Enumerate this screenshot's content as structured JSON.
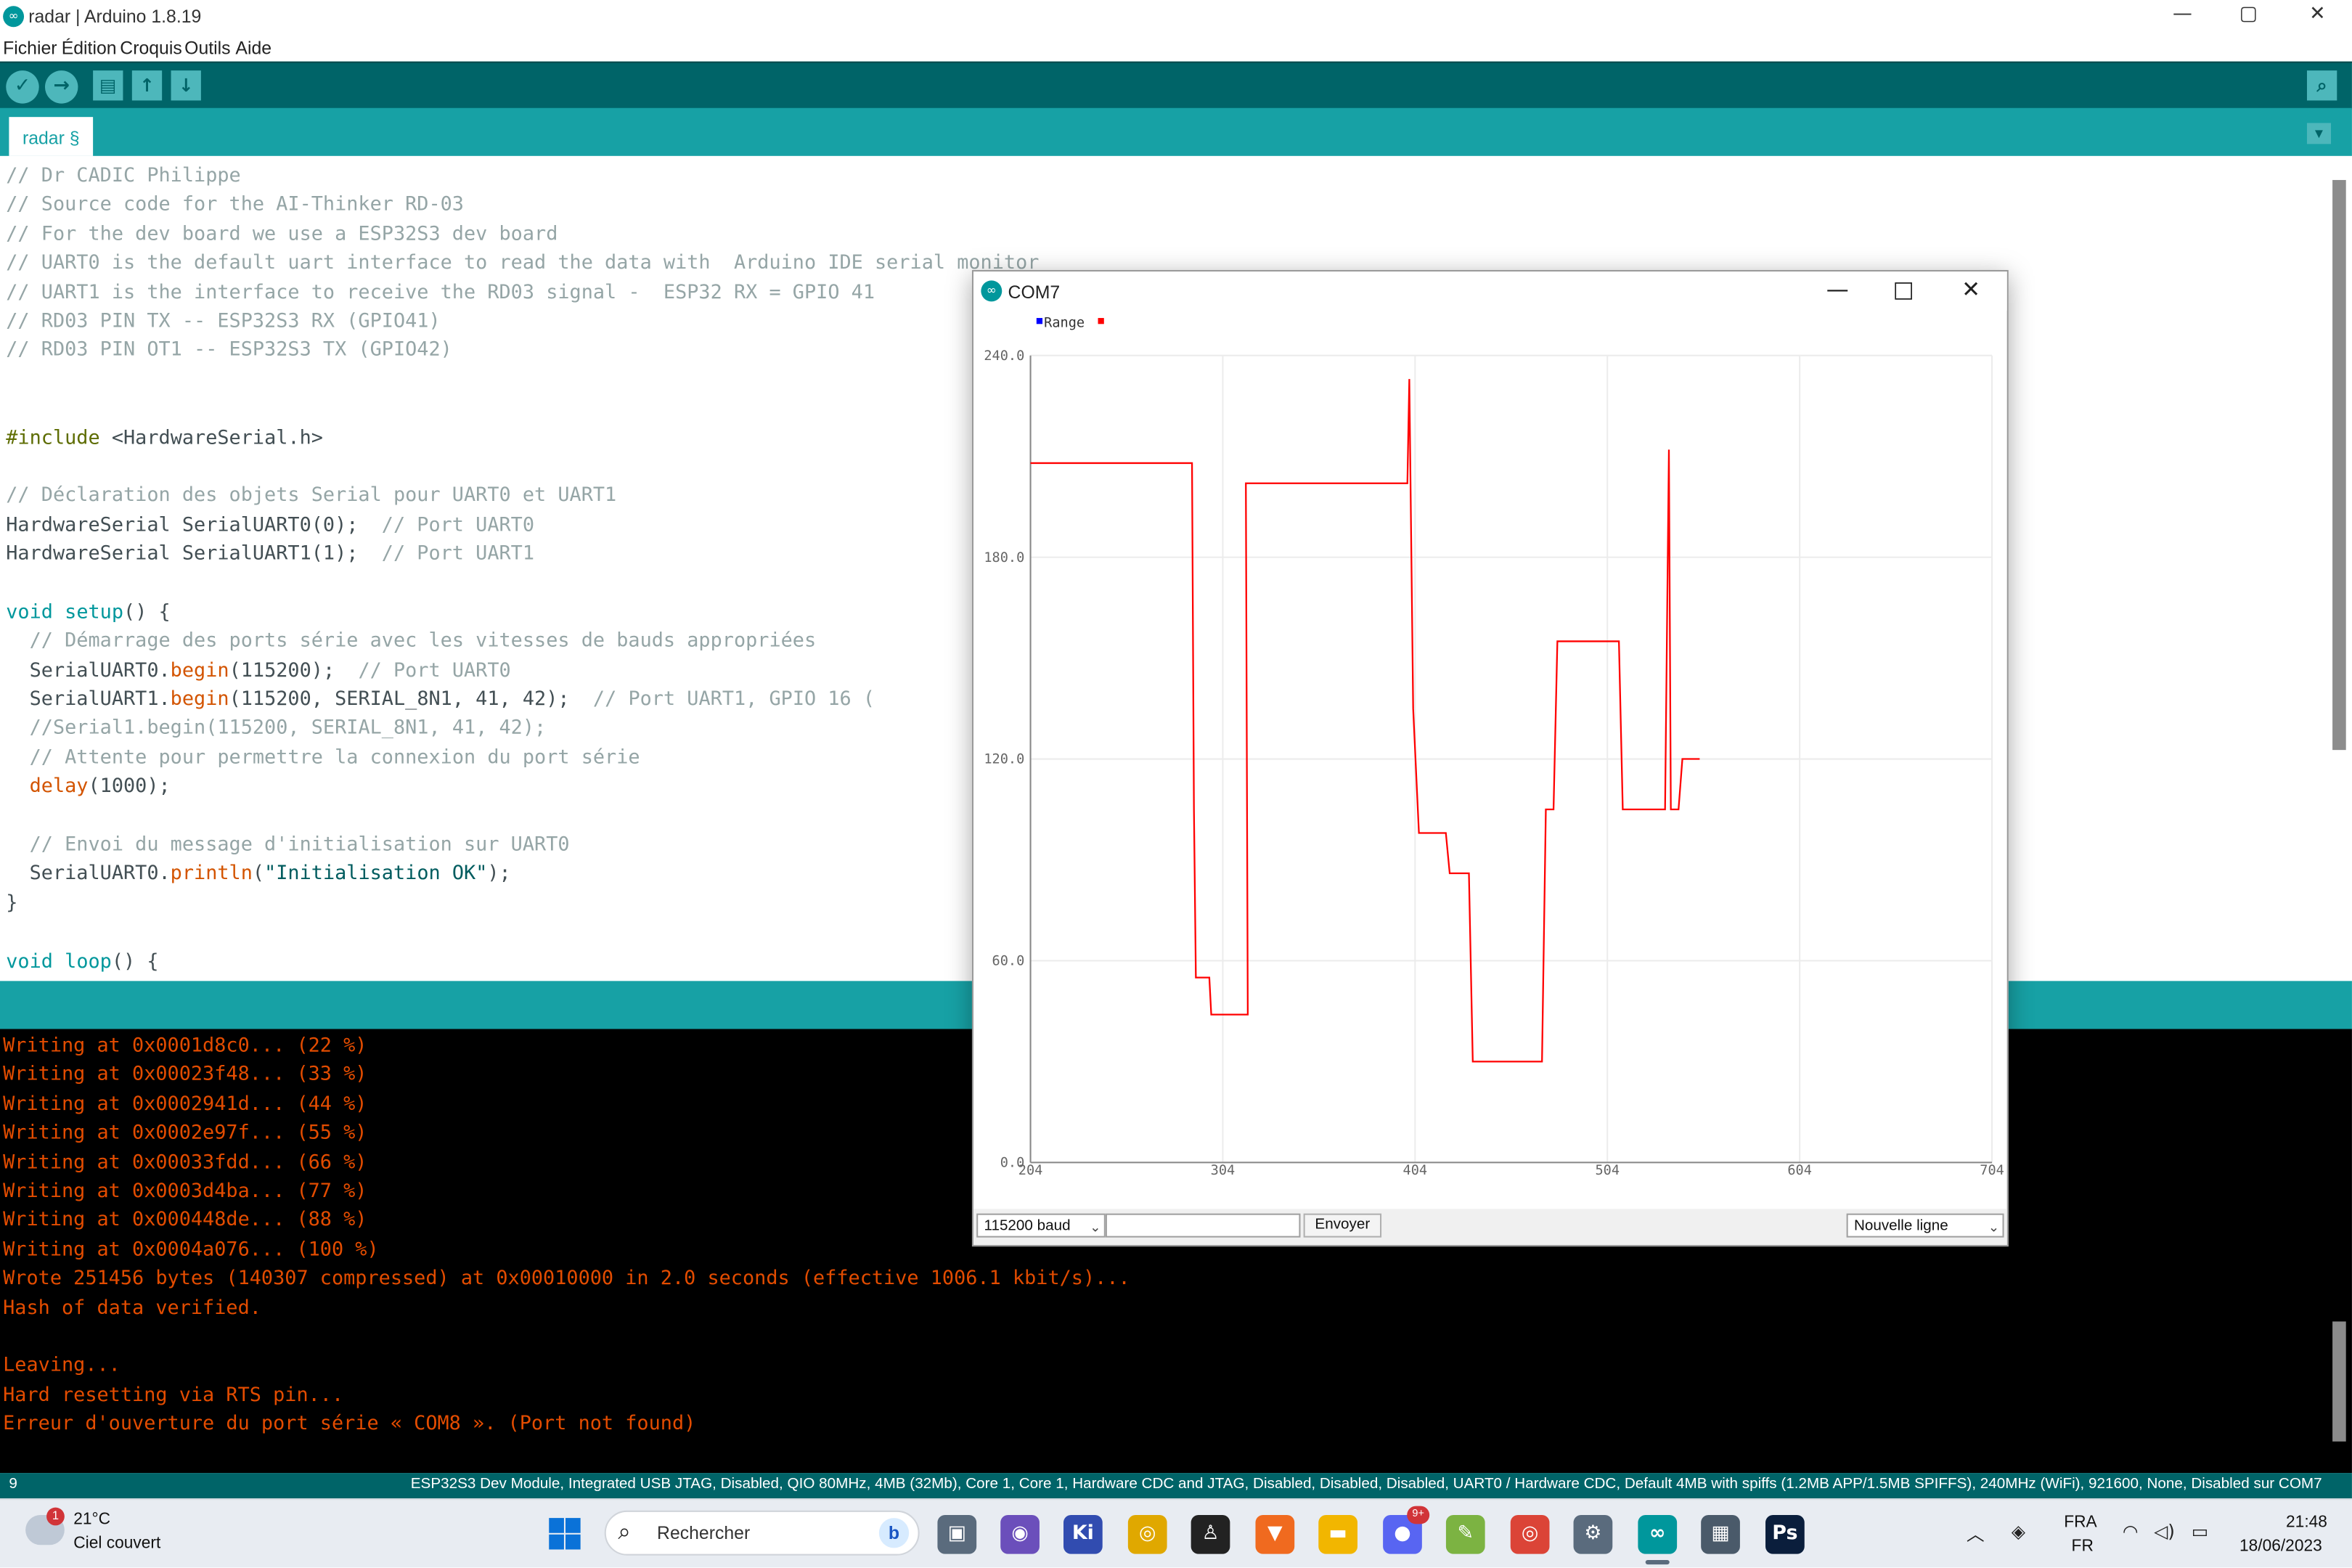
{
  "window": {
    "title": "radar | Arduino 1.8.19",
    "controls": {
      "minimize": "—",
      "maximize": "▢",
      "close": "✕"
    }
  },
  "menu": [
    "Fichier",
    "Édition",
    "Croquis",
    "Outils",
    "Aide"
  ],
  "toolbar": {
    "buttons": [
      "verify-icon",
      "upload-icon",
      "new-icon",
      "open-icon",
      "save-icon",
      "serial-monitor-icon"
    ],
    "glyphs": {
      "verify": "✓",
      "upload": "→",
      "new": "▤",
      "open": "↑",
      "save": "↓",
      "monitor": "⌕"
    }
  },
  "tab": {
    "label": "radar §",
    "menu_glyph": "▼"
  },
  "editor": {
    "lines": [
      [
        {
          "t": "// Dr CADIC Philippe",
          "c": "cm"
        }
      ],
      [
        {
          "t": "// Source code for the AI-Thinker RD-03",
          "c": "cm"
        }
      ],
      [
        {
          "t": "// For the dev board we use a ESP32S3 dev board",
          "c": "cm"
        }
      ],
      [
        {
          "t": "// UART0 is the default uart interface to read the data with  Arduino IDE serial monitor",
          "c": "cm"
        }
      ],
      [
        {
          "t": "// UART1 is the interface to receive the RD03 signal -  ESP32 RX = GPIO 41",
          "c": "cm"
        }
      ],
      [
        {
          "t": "// RD03 PIN TX -- ESP32S3 RX (GPIO41)",
          "c": "cm"
        }
      ],
      [
        {
          "t": "// RD03 PIN OT1 -- ESP32S3 TX (GPIO42)",
          "c": "cm"
        }
      ],
      [],
      [],
      [
        {
          "t": "#include",
          "c": "pp"
        },
        {
          "t": " <HardwareSerial.h>",
          "c": ""
        }
      ],
      [],
      [
        {
          "t": "// Déclaration des objets Serial pour UART0 et UART1",
          "c": "cm"
        }
      ],
      [
        {
          "t": "HardwareSerial SerialUART0(0);  ",
          "c": ""
        },
        {
          "t": "// Port UART0",
          "c": "cm"
        }
      ],
      [
        {
          "t": "HardwareSerial SerialUART1(1);  ",
          "c": ""
        },
        {
          "t": "// Port UART1",
          "c": "cm"
        }
      ],
      [],
      [
        {
          "t": "void",
          "c": "kw"
        },
        {
          "t": " ",
          "c": ""
        },
        {
          "t": "setup",
          "c": "kw"
        },
        {
          "t": "() {",
          "c": ""
        }
      ],
      [
        {
          "t": "  ",
          "c": ""
        },
        {
          "t": "// Démarrage des ports série avec les vitesses de bauds appropriées",
          "c": "cm"
        }
      ],
      [
        {
          "t": "  SerialUART0.",
          "c": ""
        },
        {
          "t": "begin",
          "c": "fn"
        },
        {
          "t": "(115200);  ",
          "c": ""
        },
        {
          "t": "// Port UART0",
          "c": "cm"
        }
      ],
      [
        {
          "t": "  SerialUART1.",
          "c": ""
        },
        {
          "t": "begin",
          "c": "fn"
        },
        {
          "t": "(115200, SERIAL_8N1, 41, 42);  ",
          "c": ""
        },
        {
          "t": "// Port UART1, GPIO 16 (",
          "c": "cm"
        }
      ],
      [
        {
          "t": "  ",
          "c": ""
        },
        {
          "t": "//Serial1.begin(115200, SERIAL_8N1, 41, 42);",
          "c": "cm"
        }
      ],
      [
        {
          "t": "  ",
          "c": ""
        },
        {
          "t": "// Attente pour permettre la connexion du port série",
          "c": "cm"
        }
      ],
      [
        {
          "t": "  ",
          "c": ""
        },
        {
          "t": "delay",
          "c": "fn"
        },
        {
          "t": "(1000);",
          "c": ""
        }
      ],
      [],
      [
        {
          "t": "  ",
          "c": ""
        },
        {
          "t": "// Envoi du message d'initialisation sur UART0",
          "c": "cm"
        }
      ],
      [
        {
          "t": "  SerialUART0.",
          "c": ""
        },
        {
          "t": "println",
          "c": "fn"
        },
        {
          "t": "(",
          "c": ""
        },
        {
          "t": "\"Initialisation OK\"",
          "c": "st"
        },
        {
          "t": ");",
          "c": ""
        }
      ],
      [
        {
          "t": "}",
          "c": ""
        }
      ],
      [],
      [
        {
          "t": "void",
          "c": "kw"
        },
        {
          "t": " ",
          "c": ""
        },
        {
          "t": "loop",
          "c": "kw"
        },
        {
          "t": "() {",
          "c": ""
        }
      ]
    ]
  },
  "console": {
    "lines": [
      "Writing at 0x0001d8c0... (22 %)",
      "Writing at 0x00023f48... (33 %)",
      "Writing at 0x0002941d... (44 %)",
      "Writing at 0x0002e97f... (55 %)",
      "Writing at 0x00033fdd... (66 %)",
      "Writing at 0x0003d4ba... (77 %)",
      "Writing at 0x000448de... (88 %)",
      "Writing at 0x0004a076... (100 %)",
      "Wrote 251456 bytes (140307 compressed) at 0x00010000 in 2.0 seconds (effective 1006.1 kbit/s)...",
      "Hash of data verified.",
      "",
      "Leaving...",
      "Hard resetting via RTS pin...",
      "Erreur d'ouverture du port série « COM8 ». (Port not found)"
    ]
  },
  "status": {
    "line_number": "9",
    "board": "ESP32S3 Dev Module, Integrated USB JTAG, Disabled, QIO 80MHz, 4MB (32Mb), Core 1, Core 1, Hardware CDC and JTAG, Disabled, Disabled, Disabled, UART0 / Hardware CDC, Default 4MB with spiffs (1.2MB APP/1.5MB SPIFFS), 240MHz (WiFi), 921600, None, Disabled sur COM7"
  },
  "plotter": {
    "title": "COM7",
    "controls": {
      "minimize": "—",
      "maximize": "□",
      "close": "✕"
    },
    "baud": "115200 baud",
    "input_value": "",
    "send_label": "Envoyer",
    "line_ending": "Nouvelle ligne",
    "select_arrow": "⌄"
  },
  "chart_data": {
    "type": "line",
    "legend": "Range",
    "legend_colors": [
      "#0000ff",
      "#ff0000"
    ],
    "series_color": "#ff0000",
    "xlim": [
      204,
      704
    ],
    "ylim": [
      0,
      240
    ],
    "x_ticks": [
      "204",
      "304",
      "404",
      "504",
      "604",
      "704"
    ],
    "y_ticks": [
      "0.0",
      "60.0",
      "120.0",
      "180.0",
      "240.0"
    ],
    "grid": true,
    "series": [
      {
        "name": "Range",
        "x": [
          204,
          288,
          289,
          290,
          294,
          297,
          298,
          306,
          307,
          315,
          317,
          316,
          395,
          396,
          399,
          400,
          401,
          403,
          406,
          420,
          422,
          432,
          434,
          470,
          472,
          476,
          478,
          482,
          484,
          510,
          512,
          532,
          534,
          536,
          537,
          538,
          541,
          543,
          552
        ],
        "y": [
          208,
          208,
          105,
          55,
          55,
          55,
          44,
          44,
          44,
          44,
          44,
          202,
          202,
          202,
          202,
          202,
          233,
          135,
          98,
          98,
          86,
          86,
          30,
          30,
          105,
          105,
          155,
          155,
          155,
          155,
          105,
          105,
          105,
          212,
          105,
          105,
          105,
          120,
          120
        ]
      }
    ]
  },
  "taskbar": {
    "weather_badge": "1",
    "temperature": "21°C",
    "condition": "Ciel couvert",
    "search_placeholder": "Rechercher",
    "search_glyph": "⌕",
    "bing_glyph": "b",
    "apps": [
      {
        "name": "task-view-icon",
        "glyph": "▣",
        "color": "#5a6b7d"
      },
      {
        "name": "video-chat-icon",
        "glyph": "◉",
        "color": "#6b4fbb"
      },
      {
        "name": "kicad-icon",
        "glyph": "Ki",
        "color": "#314cb0"
      },
      {
        "name": "chrome-icon",
        "glyph": "◎",
        "color": "#e0a800"
      },
      {
        "name": "inkscape-icon",
        "glyph": "♙",
        "color": "#222222"
      },
      {
        "name": "brave-icon",
        "glyph": "▼",
        "color": "#f06a1f"
      },
      {
        "name": "file-explorer-icon",
        "glyph": "▬",
        "color": "#f2b600"
      },
      {
        "name": "discord-icon",
        "glyph": "●",
        "color": "#5865f2"
      },
      {
        "name": "notepadpp-icon",
        "glyph": "✎",
        "color": "#7cb342"
      },
      {
        "name": "chrome-profile-icon",
        "glyph": "◎",
        "color": "#db4437"
      },
      {
        "name": "settings-icon",
        "glyph": "⚙",
        "color": "#5a6b7d"
      },
      {
        "name": "arduino-icon",
        "glyph": "∞",
        "color": "#00979c"
      },
      {
        "name": "calculator-icon",
        "glyph": "▦",
        "color": "#4a5a6a"
      },
      {
        "name": "photoshop-icon",
        "glyph": "Ps",
        "color": "#0a1e3c"
      }
    ],
    "discord_badge": "9+",
    "tray": {
      "chevron": "︿",
      "network": "◈",
      "wifi": "◠",
      "volume": "◁)",
      "battery": "▭"
    },
    "lang": "FRA",
    "layout": "FR",
    "time": "21:48",
    "date": "18/06/2023"
  }
}
